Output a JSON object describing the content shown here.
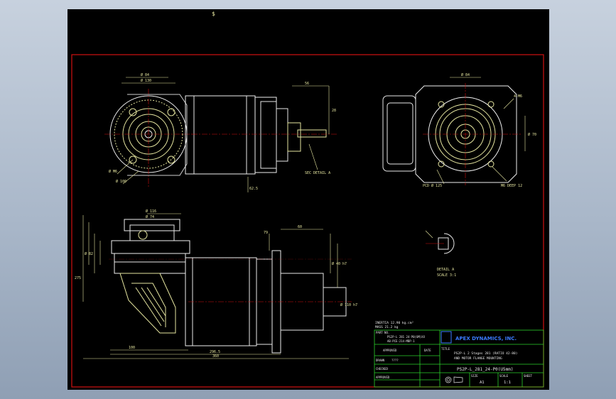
{
  "drawing": {
    "top_mark": "$",
    "detail_a_label": "DETAIL A",
    "detail_a_scale": "SCALE 3:1",
    "section_label": "SEC DETAIL A",
    "dims": {
      "left_view_top": "Ø 84",
      "left_view_top2": "Ø 130",
      "left_view_hole": "Ø M6",
      "left_view_pcd": "Ø 100",
      "right_view_top": "Ø 84",
      "right_view_pcd": "PCD Ø 125",
      "right_view_hole": "M6 DEEP 12",
      "right_view_side": "Ø 70",
      "right_view_tap": "4-M6",
      "side_dim_1": "56",
      "side_dim_2": "28",
      "side_dim_3": "62.5",
      "front_top_1": "Ø 116",
      "front_top_2": "Ø 74",
      "front_height_1": "275",
      "front_height_2": "Ø 82",
      "front_shaft_1": "79",
      "front_shaft_2": "60",
      "front_shaft_3": "Ø 40 h7",
      "front_shaft_4": "Ø 110 h7",
      "front_bottom_1": "100",
      "front_bottom_2": "296.5",
      "front_bottom_3": "360"
    }
  },
  "title_block": {
    "inertia": "INERTIA 12.90 kg.cm²",
    "mass": "MASS 21.2 kg",
    "part_no_label": "PART NO.",
    "part_no_1": "PS2P-L 281 24-P0(UM)XX",
    "part_no_2": "AB-PCE-214-MBP-1",
    "drawn_label": "DRAWN",
    "drawn_value": "????",
    "checked_label": "CHECKED",
    "approved_label": "APPROVED",
    "approved_col": "APPROVED",
    "date_col": "DATE",
    "company": "APEX DYNAMICS, INC.",
    "title_label": "TITLE",
    "title_1": "PS2P-L 2 Stages 281 (RATIO 42-80)",
    "title_2": "AND MOTOR FLANGE MOUNTING",
    "drawing_no": "PS2P-L_281_24-P0(U5mm)",
    "size_label": "SIZE",
    "size_value": "A1",
    "scale_label": "SCALE",
    "scale_value": "1:1",
    "sheet_label": "SHEET"
  }
}
